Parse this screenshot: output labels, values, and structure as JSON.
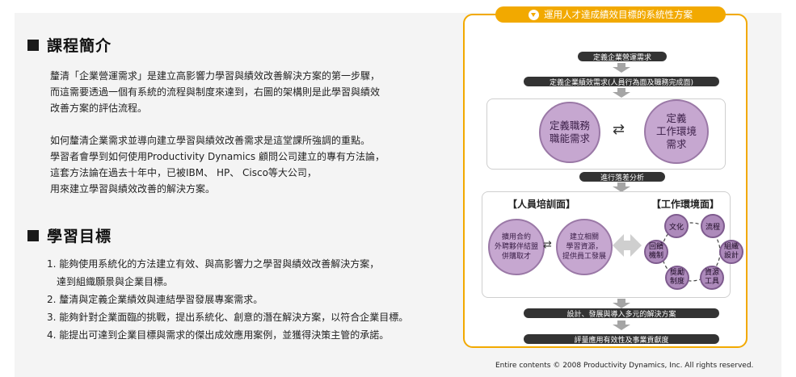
{
  "intro": {
    "heading": "課程簡介",
    "paragraph1": [
      "釐清「企業營運需求」是建立高影響力學習與績效改善解決方案的第一步驟，",
      "而這需要透過一個有系統的流程與制度來達到，右圖的架構則是此學習與績效",
      "改善方案的評估流程。"
    ],
    "paragraph2": [
      "如何釐清企業需求並導向建立學習與績效改善需求是這堂課所強調的重點。",
      "學習者會學到如何使用Productivity Dynamics 顧問公司建立的專有方法論，",
      "這套方法論在過去十年中，已被IBM、 HP、 Cisco等大公司，",
      "用來建立學習與績效改善的解決方案。"
    ]
  },
  "goals": {
    "heading": "學習目標",
    "items": [
      "1. 能夠使用系統化的方法建立有效、與高影響力之學習與績效改善解決方案，",
      "達到組織願景與企業目標。",
      "2. 釐清與定義企業績效與連結學習發展專案需求。",
      "3. 能夠針對企業面臨的挑戰，提出系統化、創意的潛在解決方案，以符合企業目標。",
      "4. 能提出可達到企業目標與需求的傑出成效應用案例，並獲得決策主管的承諾。"
    ]
  },
  "diagram": {
    "title": "運用人才達成績效目標的系統性方案",
    "step1": "定義企業營運需求",
    "step2": "定義企業績效需求(人員行為面及職務完成面)",
    "circle_left": [
      "定義職務",
      "職能需求"
    ],
    "circle_right": [
      "定義",
      "工作環境",
      "需求"
    ],
    "exchange_symbol": "⇄",
    "step3": "進行落差分析",
    "people_label": "【人員培訓面】",
    "env_label": "【工作環境面】",
    "people_circle1": [
      "擴用合約",
      "外聘夥伴結盟",
      "併購取才"
    ],
    "people_circle2": [
      "建立相關",
      "學習資源，",
      "提供員工發展"
    ],
    "env_circles": {
      "culture": "文化",
      "process": "流程",
      "org": [
        "組織",
        "設計"
      ],
      "resources": [
        "資源",
        "工具"
      ],
      "incentive": [
        "獎勵",
        "制度"
      ],
      "feedback": [
        "回饋",
        "機制"
      ]
    },
    "step4": "設計、發展與導入多元的解決方案",
    "step5": "評量應用有效性及事業貢獻度"
  },
  "footer": {
    "copyright": "Entire contents © 2008 Productivity Dynamics, Inc. All rights reserved."
  },
  "colors": {
    "accent": "#f2a900",
    "circle_fill": "#c6a7d0",
    "bar_fill": "#333333"
  }
}
